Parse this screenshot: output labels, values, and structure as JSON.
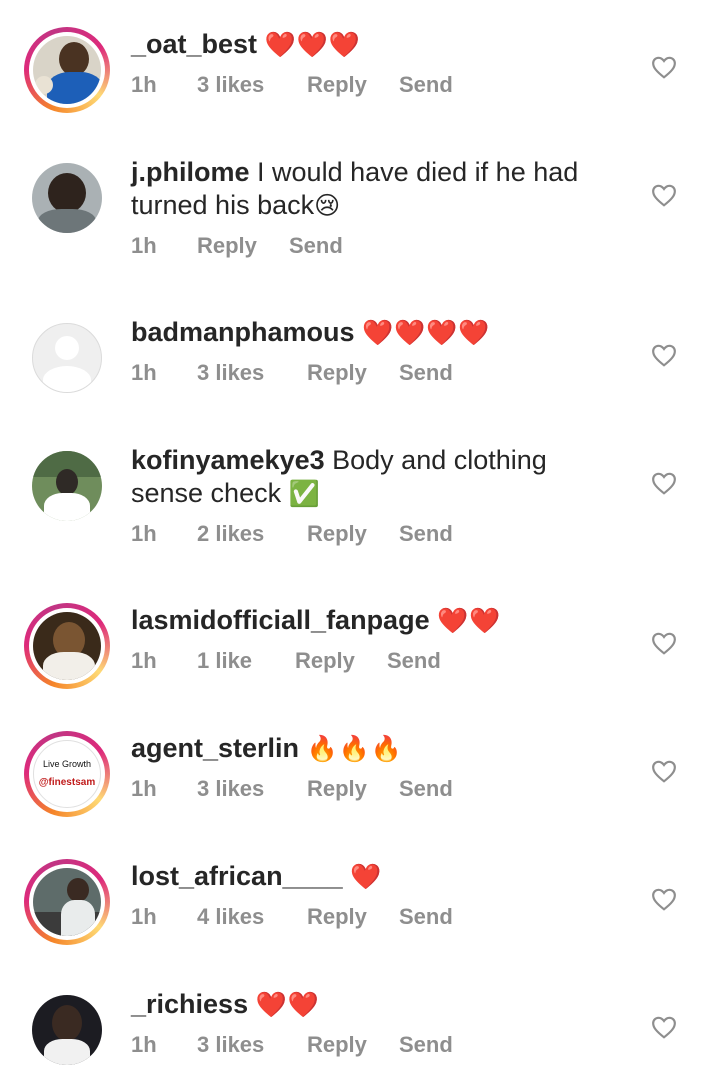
{
  "comments": [
    {
      "username": "_oat_best",
      "text": "",
      "emoji": "❤️❤️❤️",
      "time": "1h",
      "likes": "3 likes",
      "reply": "Reply",
      "send": "Send",
      "story": true,
      "avatar_colors": [
        "#1d5fb8",
        "#6b4a2f",
        "#e9e2d4"
      ]
    },
    {
      "username": "j.philome",
      "text": "I would have died if he had turned his back",
      "emoji": "😢",
      "time": "1h",
      "likes": "",
      "reply": "Reply",
      "send": "Send",
      "story": false,
      "avatar_colors": [
        "#9aa3a6",
        "#2e231d",
        "#c9cfd1"
      ]
    },
    {
      "username": "badmanphamous",
      "text": "",
      "emoji": "❤️❤️❤️❤️",
      "time": "1h",
      "likes": "3 likes",
      "reply": "Reply",
      "send": "Send",
      "story": false,
      "avatar_colors": [
        "#dbdbdb",
        "#ffffff",
        "#efefef"
      ]
    },
    {
      "username": "kofinyamekye3",
      "text": "Body and clothing sense check",
      "emoji": "✅",
      "time": "1h",
      "likes": "2 likes",
      "reply": "Reply",
      "send": "Send",
      "story": false,
      "avatar_colors": [
        "#6f8d5c",
        "#2f2a26",
        "#ffffff"
      ]
    },
    {
      "username": "lasmidofficiall_fanpage",
      "text": "",
      "emoji": "❤️❤️",
      "time": "1h",
      "likes": "1 like",
      "reply": "Reply",
      "send": "Send",
      "story": true,
      "avatar_colors": [
        "#3a2a1a",
        "#7a5532",
        "#f2efe9"
      ]
    },
    {
      "username": "agent_sterlin",
      "text": "",
      "emoji": "🔥🔥🔥",
      "time": "1h",
      "likes": "3 likes",
      "reply": "Reply",
      "send": "Send",
      "story": true,
      "avatar_text": [
        "Live Growth",
        "@finestsam"
      ],
      "avatar_colors": [
        "#ffffff",
        "#111111",
        "#c01b1b"
      ]
    },
    {
      "username": "lost_african____",
      "text": "",
      "emoji": "❤️",
      "time": "1h",
      "likes": "4 likes",
      "reply": "Reply",
      "send": "Send",
      "story": true,
      "avatar_colors": [
        "#5e6c6a",
        "#e9ecec",
        "#3b3b3b"
      ]
    },
    {
      "username": "_richiess",
      "text": "",
      "emoji": "❤️❤️",
      "time": "1h",
      "likes": "3 likes",
      "reply": "Reply",
      "send": "Send",
      "story": false,
      "avatar_colors": [
        "#1c1c22",
        "#3a2a22",
        "#f1f1f1"
      ]
    }
  ]
}
